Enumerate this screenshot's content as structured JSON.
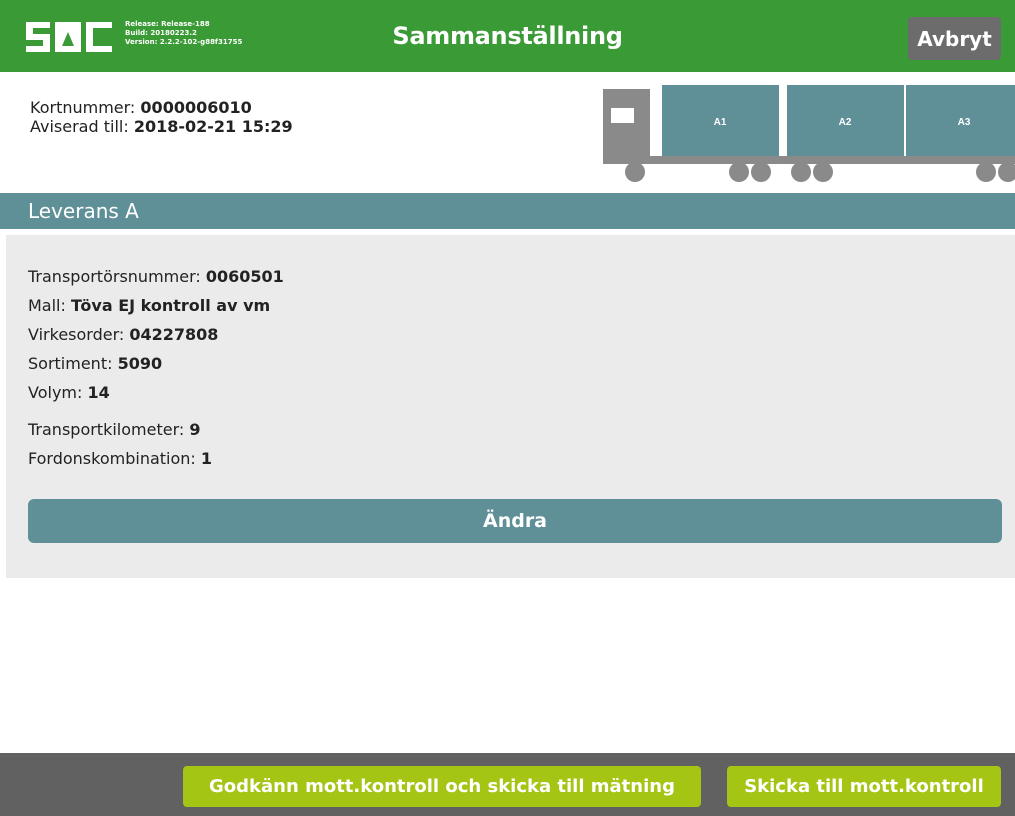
{
  "header": {
    "logo_text": "SDC",
    "build": {
      "release": "Release: Release-188",
      "build": "Build: 20180223.2",
      "version": "Version: 2.2.2-102-g88f31755"
    },
    "title": "Sammanställning",
    "cancel_label": "Avbryt"
  },
  "summary": {
    "card_label": "Kortnummer:",
    "card_value": "0000006010",
    "announced_label": "Aviserad till:",
    "announced_value": "2018-02-21 15:29"
  },
  "truck": {
    "compartments": [
      "A1",
      "A2",
      "A3"
    ]
  },
  "delivery": {
    "title": "Leverans A",
    "fields": [
      {
        "label": "Transportörsnummer:",
        "value": "0060501"
      },
      {
        "label": "Mall:",
        "value": "Töva EJ kontroll av vm"
      },
      {
        "label": "Virkesorder:",
        "value": "04227808"
      },
      {
        "label": "Sortiment:",
        "value": "5090"
      },
      {
        "label": "Volym:",
        "value": "14"
      },
      {
        "label": "Transportkilometer:",
        "value": "9"
      },
      {
        "label": "Fordonskombination:",
        "value": "1"
      }
    ],
    "edit_label": "Ändra"
  },
  "footer": {
    "approve_label": "Godkänn mott.kontroll och skicka till mätning",
    "send_label": "Skicka till mott.kontroll"
  },
  "colors": {
    "header_green": "#3a9a36",
    "teal": "#5f8f97",
    "button_lime": "#a4c514",
    "footer_gray": "#616161",
    "truck_gray": "#8a8a8a"
  }
}
